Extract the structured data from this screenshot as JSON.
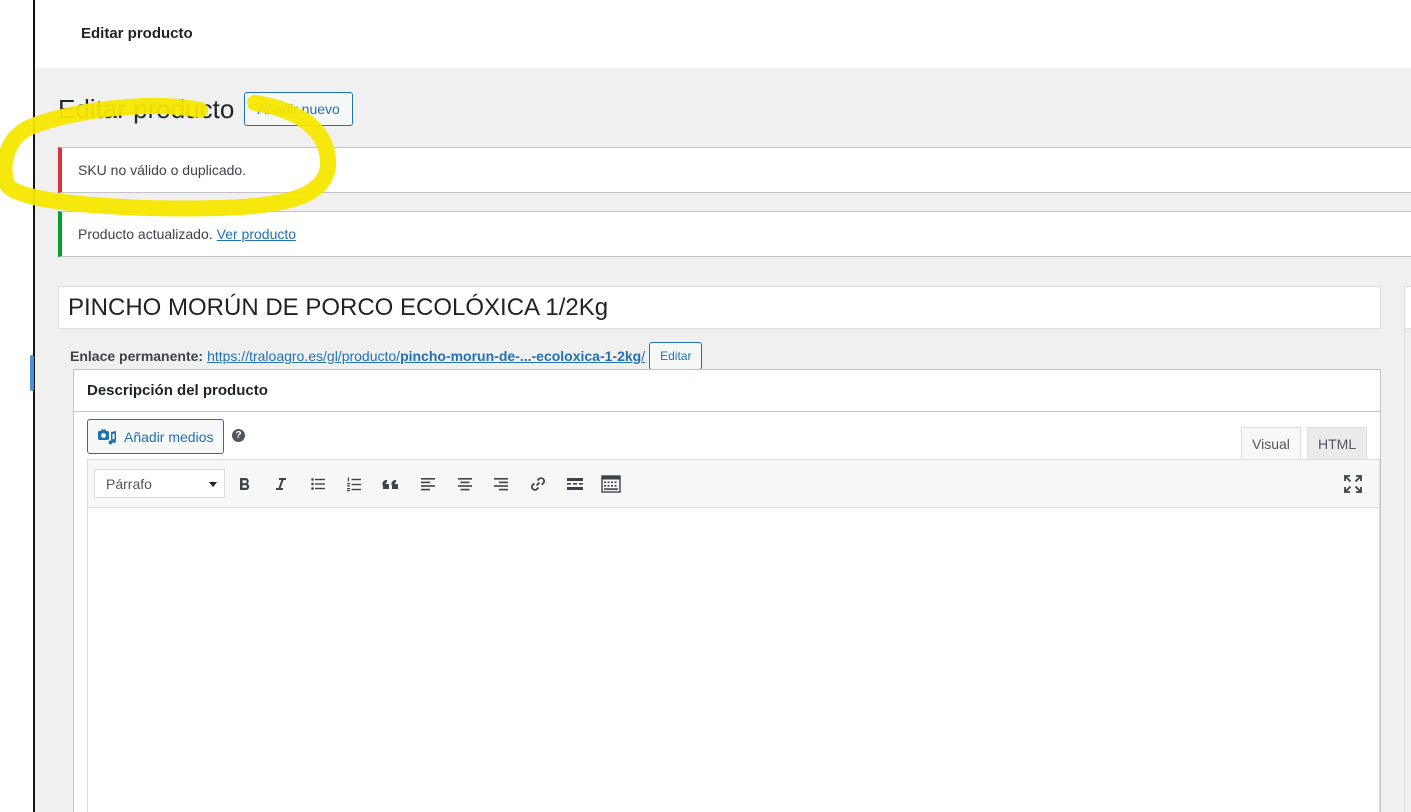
{
  "topbar": {
    "title": "Editar producto"
  },
  "page": {
    "title": "Editar producto",
    "add_new_label": "Añadir nuevo"
  },
  "notices": {
    "error": {
      "text": "SKU no válido o duplicado.",
      "color": "#d63638"
    },
    "success": {
      "text": "Producto actualizado.",
      "link_label": "Ver producto",
      "color": "#00a32a"
    }
  },
  "product": {
    "title": "PINCHO MORÚN DE PORCO ECOLÓXICA 1/2Kg"
  },
  "permalink": {
    "label": "Enlace permanente:",
    "url_base": "https://traloagro.es/gl/producto/",
    "slug": "pincho-morun-de-...-ecoloxica-1-2kg",
    "url_suffix": "/",
    "edit_label": "Editar"
  },
  "description_box": {
    "title": "Descripción del producto",
    "add_media_label": "Añadir medios",
    "tabs": {
      "visual": "Visual",
      "html": "HTML"
    },
    "format_select": {
      "selected": "Párrafo"
    },
    "toolbar_icons": [
      "bold-icon",
      "italic-icon",
      "bulleted-list-icon",
      "numbered-list-icon",
      "blockquote-icon",
      "align-left-icon",
      "align-center-icon",
      "align-right-icon",
      "insert-link-icon",
      "read-more-icon",
      "toolbar-toggle-icon"
    ],
    "fullscreen_icon": "fullscreen-icon"
  },
  "colors": {
    "accent": "#2271b1",
    "highlight": "#f5e600"
  }
}
